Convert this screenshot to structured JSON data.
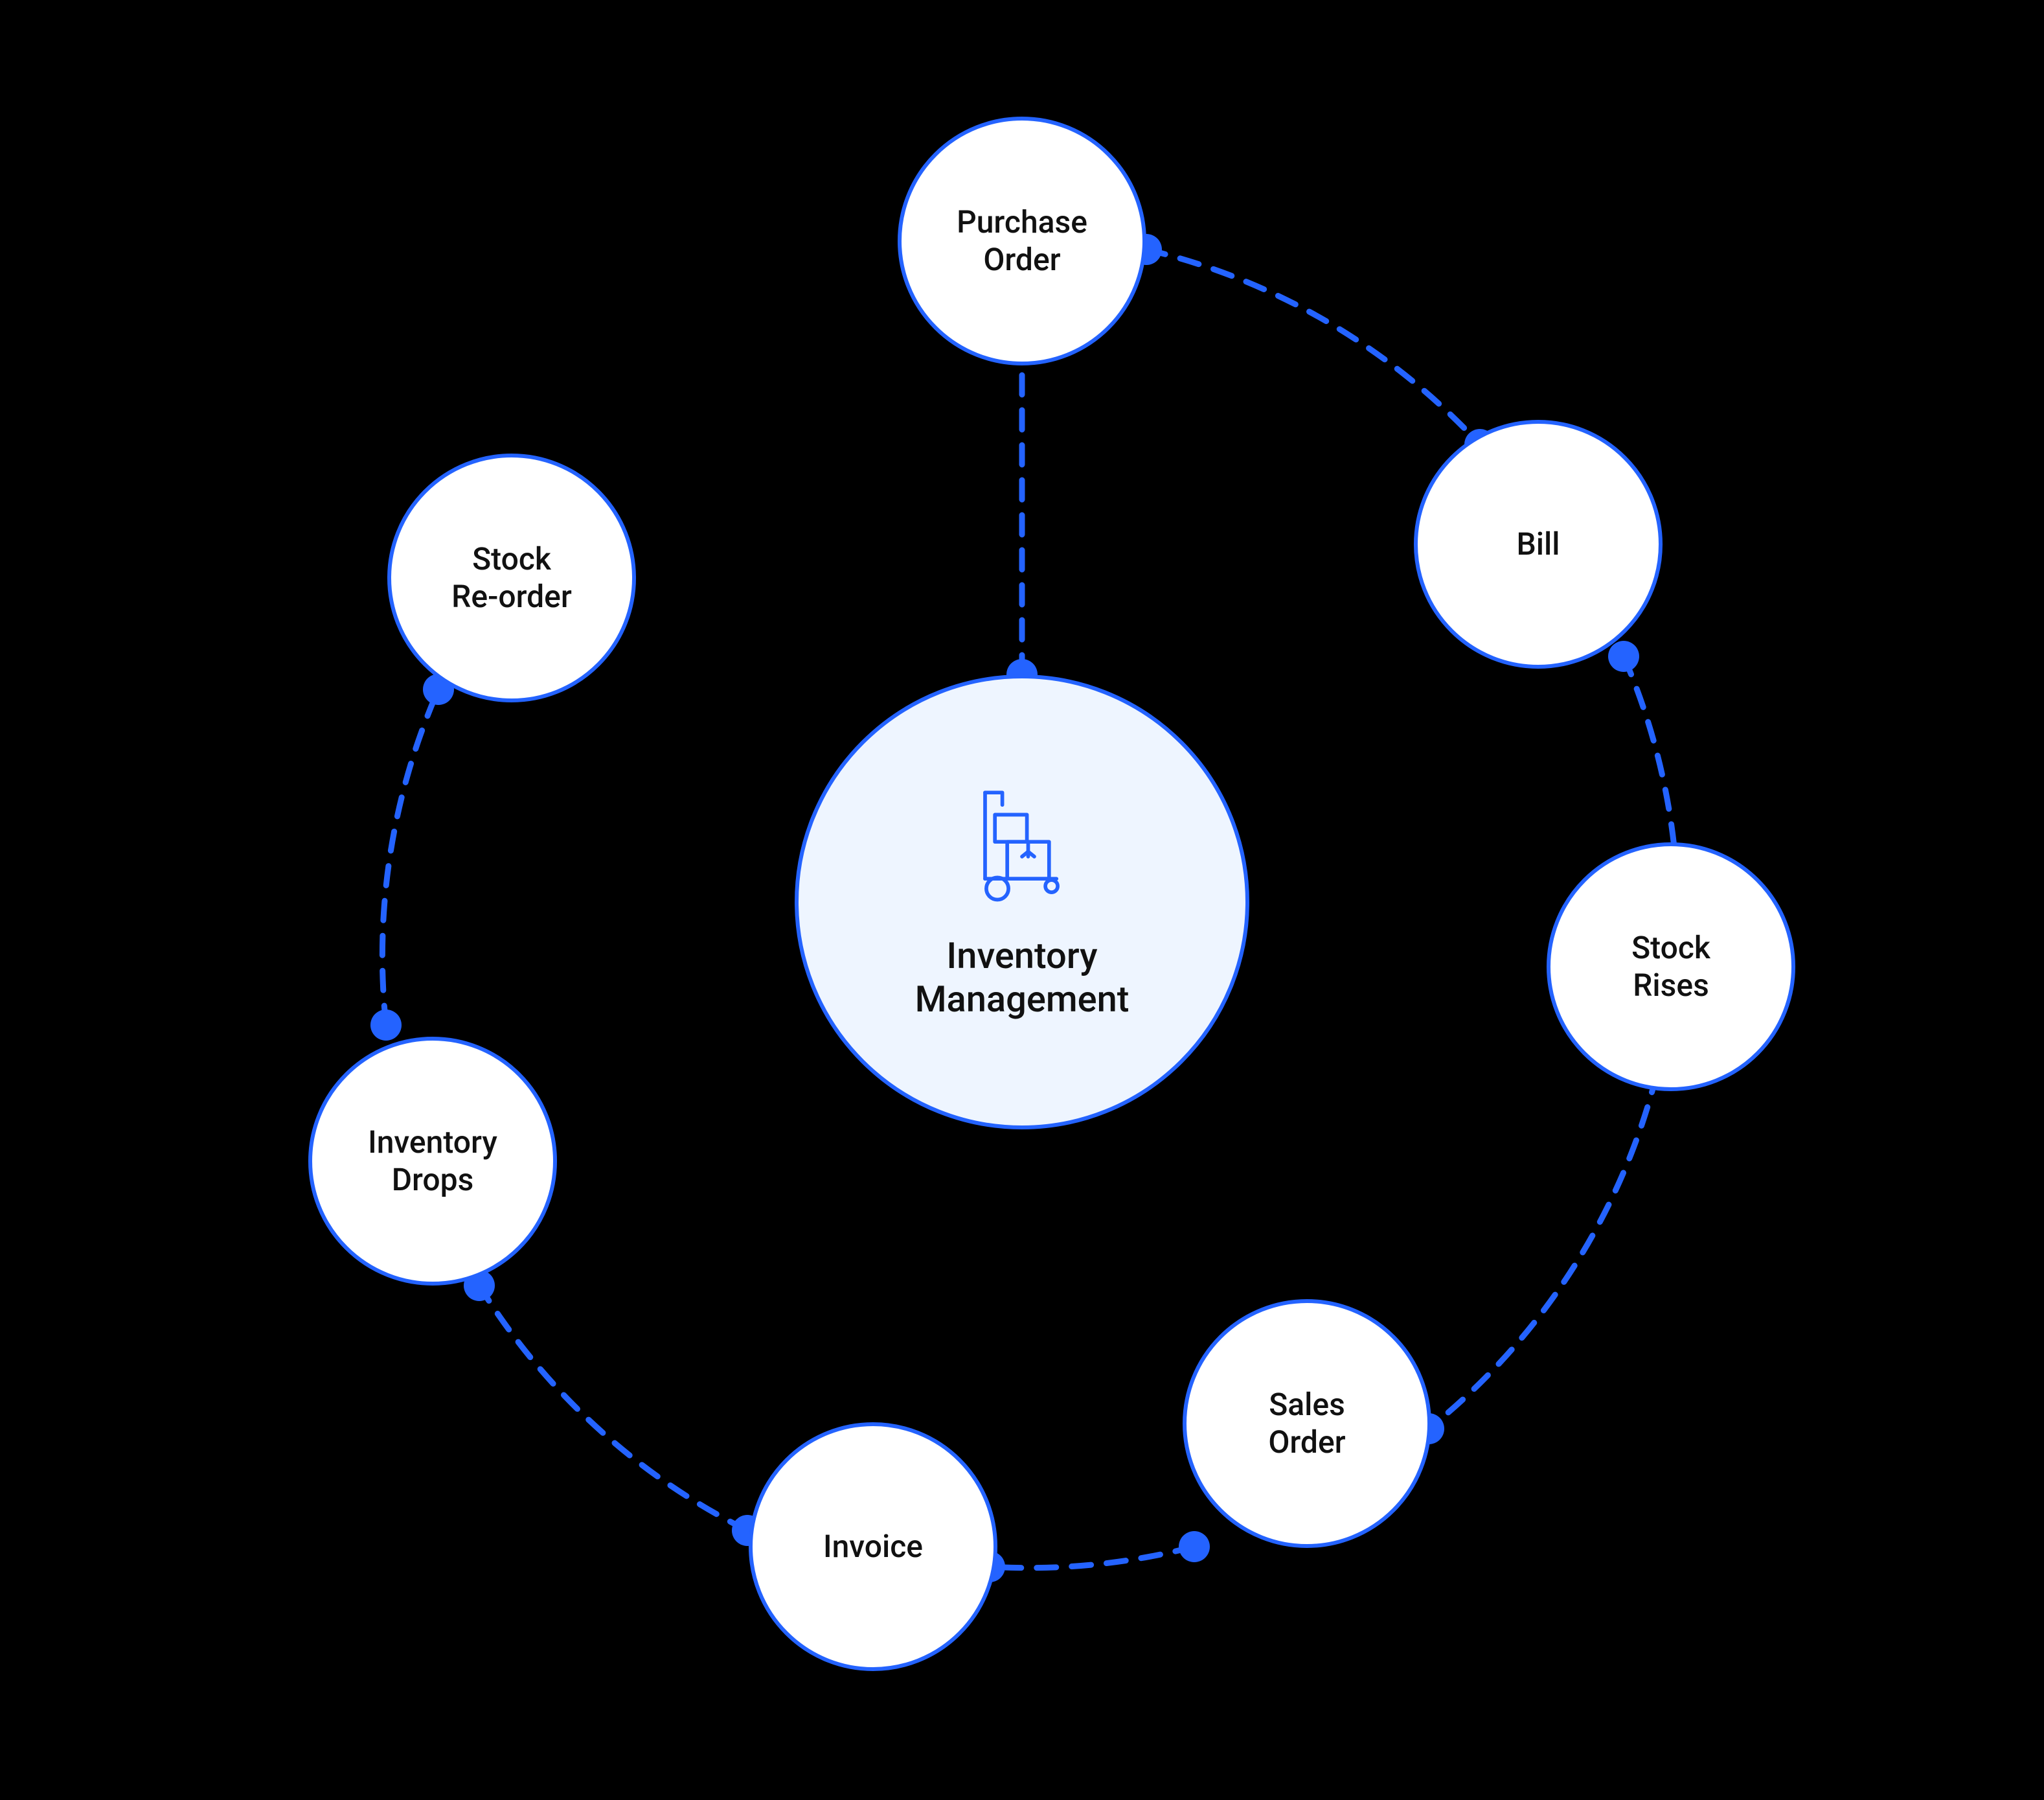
{
  "diagram": {
    "center": {
      "label": "Inventory Management",
      "icon": "hand-truck-icon"
    },
    "nodes": [
      {
        "id": "purchase-order",
        "label": "Purchase Order"
      },
      {
        "id": "bill",
        "label": "Bill"
      },
      {
        "id": "stock-rises",
        "label": "Stock Rises"
      },
      {
        "id": "sales-order",
        "label": "Sales Order"
      },
      {
        "id": "invoice",
        "label": "Invoice"
      },
      {
        "id": "inventory-drops",
        "label": "Inventory Drops"
      },
      {
        "id": "stock-reorder",
        "label": "Stock Re-order"
      }
    ],
    "colors": {
      "accent": "#2463ff",
      "center_fill": "#eef5ff",
      "node_fill": "#ffffff",
      "background": "#000000",
      "text": "#111111"
    }
  }
}
